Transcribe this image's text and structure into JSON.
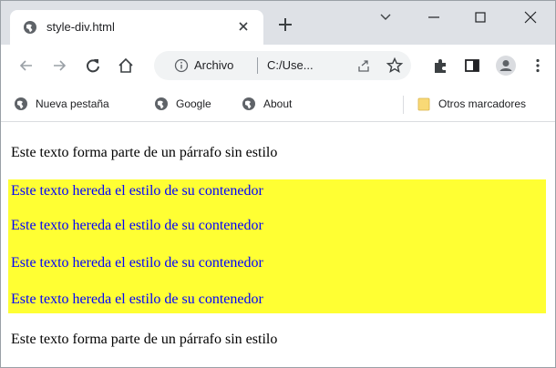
{
  "tab": {
    "title": "style-div.html"
  },
  "toolbar": {
    "site_chip": "Archivo",
    "url": "C:/Use..."
  },
  "bookmarks": {
    "items": [
      "Nueva pestaña",
      "Google",
      "About"
    ],
    "other": "Otros marcadores"
  },
  "content": {
    "plain_paragraph": "Este texto forma parte de un párrafo sin estilo",
    "styled_paragraph": "Este texto hereda el estilo de su contenedor"
  },
  "colors": {
    "div_background": "#ffff33",
    "styled_text": "#0000ff",
    "plain_text": "#000000"
  },
  "icons": [
    "globe-icon",
    "close-icon",
    "plus-icon",
    "chevron-down-icon",
    "minimize-icon",
    "maximize-icon",
    "window-close-icon",
    "back-icon",
    "forward-icon",
    "reload-icon",
    "home-icon",
    "info-icon",
    "share-icon",
    "star-icon",
    "extensions-icon",
    "side-panel-icon",
    "profile-icon",
    "menu-icon",
    "folder-icon"
  ]
}
